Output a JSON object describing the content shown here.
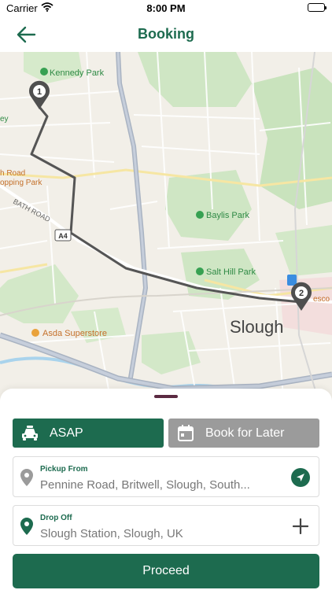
{
  "status_bar": {
    "carrier": "Carrier",
    "time": "8:00 PM"
  },
  "header": {
    "title": "Booking"
  },
  "map": {
    "labels": {
      "kennedy_park": "Kennedy Park",
      "bath_road_line1": "h Road",
      "bath_road_line2": "opping Park",
      "bath_road": "BATH ROAD",
      "edge_left": "ey",
      "road_badge": "A4",
      "baylis_park": "Baylis Park",
      "salt_hill_park": "Salt Hill Park",
      "asda": "Asda Superstore",
      "slough": "Slough",
      "tesco": "esco"
    },
    "markers": {
      "start": "1",
      "end": "2"
    }
  },
  "booking": {
    "asap_label": "ASAP",
    "later_label": "Book for Later",
    "pickup": {
      "label": "Pickup From",
      "value": "Pennine Road, Britwell, Slough, South..."
    },
    "dropoff": {
      "label": "Drop Off",
      "value": "Slough Station, Slough, UK"
    },
    "proceed_label": "Proceed"
  },
  "colors": {
    "primary": "#1d6b4f",
    "inactive": "#9b9b9b",
    "route": "#555555"
  }
}
